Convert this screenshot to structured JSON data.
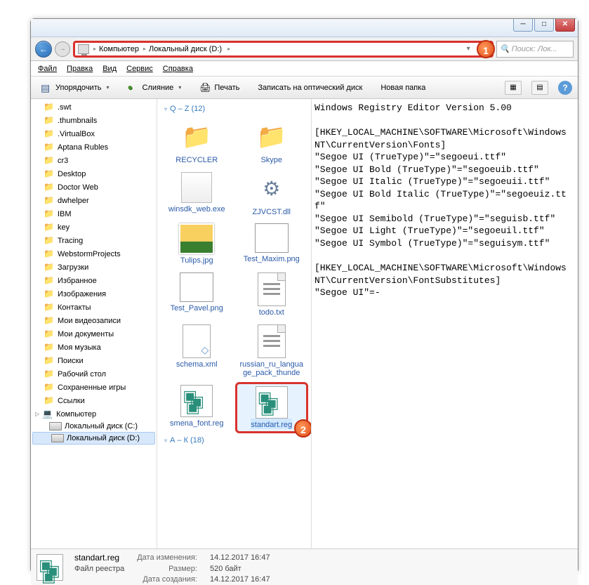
{
  "titlebar": {
    "minimize": "─",
    "maximize": "□",
    "close": "✕"
  },
  "nav": {
    "back": "←",
    "forward": "→",
    "crumbs": [
      "Компьютер",
      "Локальный диск (D:)"
    ],
    "dropdown": "▾",
    "refresh": "↻",
    "search_placeholder": "Поиск: Лок..."
  },
  "markers": {
    "one": "1",
    "two": "2"
  },
  "menubar": [
    "Файл",
    "Правка",
    "Вид",
    "Сервис",
    "Справка"
  ],
  "toolbar": {
    "organize": "Упорядочить",
    "merge": "Слияние",
    "print": "Печать",
    "burn": "Записать на оптический диск",
    "new_folder": "Новая папка",
    "views": "▦",
    "preview": "▤",
    "help": "?"
  },
  "sidebar": {
    "items": [
      ".swt",
      ".thumbnails",
      ".VirtualBox",
      "Aptana Rubles",
      "cr3",
      "Desktop",
      "Doctor Web",
      "dwhelper",
      "IBM",
      "key",
      "Tracing",
      "WebstormProjects",
      "Загрузки",
      "Избранное",
      "Изображения",
      "Контакты",
      "Мои видеозаписи",
      "Мои документы",
      "Моя музыка",
      "Поиски",
      "Рабочий стол",
      "Сохраненные игры",
      "Ссылки"
    ],
    "computer": "Компьютер",
    "drive_c": "Локальный диск (C:)",
    "drive_d": "Локальный диск (D:)"
  },
  "files": {
    "group1": "Q – Z (12)",
    "group2": "А – К (18)",
    "items": [
      {
        "name": "RECYCLER",
        "type": "folder"
      },
      {
        "name": "Skype",
        "type": "folder"
      },
      {
        "name": "winsdk_web.exe",
        "type": "exe"
      },
      {
        "name": "ZJVCST.dll",
        "type": "dll"
      },
      {
        "name": "Tulips.jpg",
        "type": "jpg"
      },
      {
        "name": "Test_Maxim.png",
        "type": "png"
      },
      {
        "name": "Test_Pavel.png",
        "type": "png"
      },
      {
        "name": "todo.txt",
        "type": "txt"
      },
      {
        "name": "schema.xml",
        "type": "xml"
      },
      {
        "name": "russian_ru_language_pack_thunde",
        "type": "txt"
      },
      {
        "name": "smena_font.reg",
        "type": "reg"
      },
      {
        "name": "standart.reg",
        "type": "reg"
      }
    ],
    "selected_index": 11
  },
  "preview_text": "Windows Registry Editor Version 5.00\n\n[HKEY_LOCAL_MACHINE\\SOFTWARE\\Microsoft\\Windows NT\\CurrentVersion\\Fonts]\n\"Segoe UI (TrueType)\"=\"segoeui.ttf\"\n\"Segoe UI Bold (TrueType)\"=\"segoeuib.ttf\"\n\"Segoe UI Italic (TrueType)\"=\"segoeuii.ttf\"\n\"Segoe UI Bold Italic (TrueType)\"=\"segoeuiz.ttf\"\n\"Segoe UI Semibold (TrueType)\"=\"seguisb.ttf\"\n\"Segoe UI Light (TrueType)\"=\"segoeuil.ttf\"\n\"Segoe UI Symbol (TrueType)\"=\"seguisym.ttf\"\n\n[HKEY_LOCAL_MACHINE\\SOFTWARE\\Microsoft\\Windows NT\\CurrentVersion\\FontSubstitutes]\n\"Segoe UI\"=-",
  "status": {
    "filename": "standart.reg",
    "filetype": "Файл реестра",
    "date_label": "Дата изменения:",
    "date_value": "14.12.2017 16:47",
    "size_label": "Размер:",
    "size_value": "520 байт",
    "created_label": "Дата создания:",
    "created_value": "14.12.2017 16:47"
  }
}
